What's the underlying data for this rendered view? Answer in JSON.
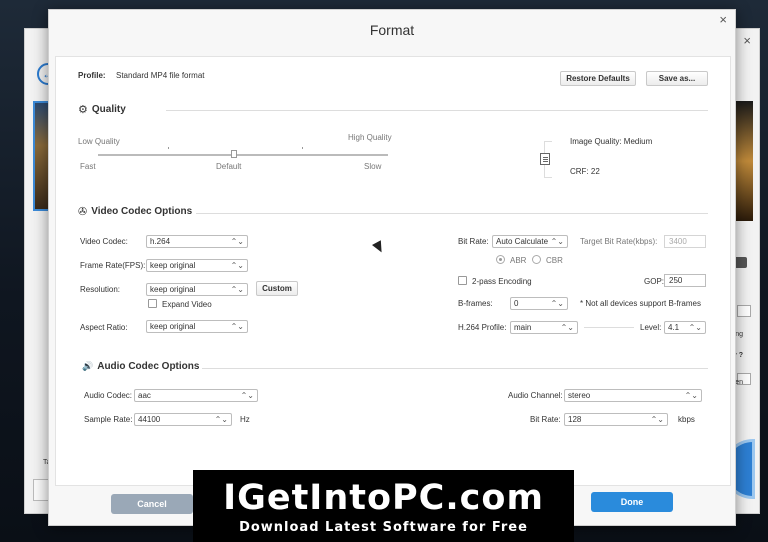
{
  "background_app": {
    "close_glyph": "×",
    "back_glyph": "←",
    "fragment_1": "ting",
    "fragment_2": "y ?",
    "fragment_3": "en",
    "tab_fragment": "Ta"
  },
  "dialog": {
    "title": "Format",
    "close_glyph": "×",
    "profile_label": "Profile:",
    "profile_value": "Standard MP4 file format",
    "restore_defaults": "Restore Defaults",
    "save_as": "Save as..."
  },
  "quality": {
    "title": "Quality",
    "low": "Low Quality",
    "high": "High Quality",
    "fast": "Fast",
    "default": "Default",
    "slow": "Slow",
    "slider_position": 0.5,
    "image_quality": "Image Quality: Medium",
    "crf": "CRF: 22"
  },
  "video": {
    "title": "Video Codec Options",
    "codec_label": "Video Codec:",
    "codec_value": "h.264",
    "fps_label": "Frame Rate(FPS):",
    "fps_value": "keep original",
    "resolution_label": "Resolution:",
    "resolution_value": "keep original",
    "custom_button": "Custom",
    "expand_video": "Expand Video",
    "aspect_label": "Aspect Ratio:",
    "aspect_value": "keep original",
    "bitrate_label": "Bit Rate:",
    "bitrate_value": "Auto Calculate",
    "target_label": "Target Bit Rate(kbps):",
    "target_value": "3400",
    "abr": "ABR",
    "cbr": "CBR",
    "twopass": "2-pass Encoding",
    "gop_label": "GOP:",
    "gop_value": "250",
    "bframes_label": "B-frames:",
    "bframes_value": "0",
    "bframes_note": "* Not all devices support B-frames",
    "profile_label": "H.264 Profile:",
    "profile_value": "main",
    "level_label": "Level:",
    "level_value": "4.1"
  },
  "audio": {
    "title": "Audio Codec Options",
    "codec_label": "Audio Codec:",
    "codec_value": "aac",
    "sample_label": "Sample Rate:",
    "sample_value": "44100",
    "hz": "Hz",
    "channel_label": "Audio Channel:",
    "channel_value": "stereo",
    "bitrate_label": "Bit Rate:",
    "bitrate_value": "128",
    "kbps": "kbps"
  },
  "footer": {
    "cancel": "Cancel",
    "done": "Done"
  },
  "watermark": {
    "main": "IGetIntoPC.com",
    "sub": "Download Latest Software for Free"
  },
  "icons": {
    "chevron": "⌃⌄",
    "gear": "⚙",
    "reel": "✇",
    "speaker": "🔊"
  },
  "colors": {
    "done_button": "#2a8bdc",
    "cancel_button": "#9aa8b7"
  }
}
